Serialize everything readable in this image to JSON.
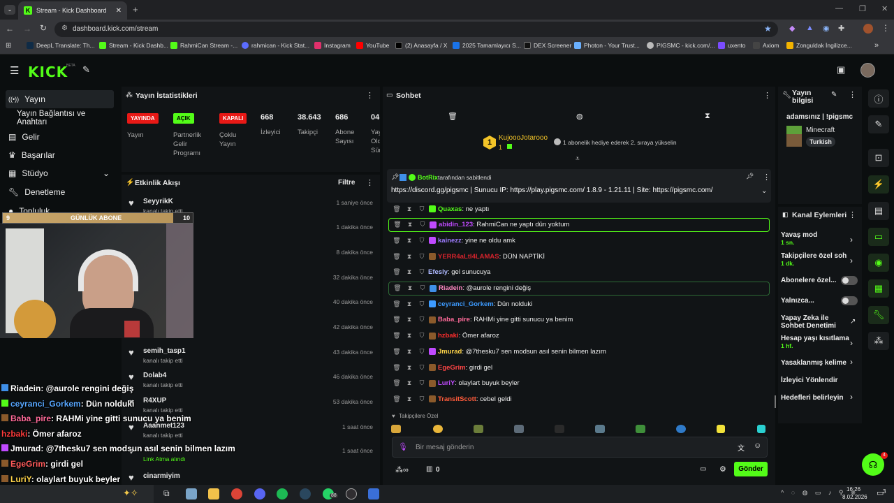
{
  "browser": {
    "tab_title": "Stream - Kick Dashboard",
    "url": "dashboard.kick.com/stream",
    "bookmarks": [
      "DeepL Translate: Th...",
      "Stream - Kick Dashb...",
      "RahmiCan Stream -...",
      "rahmican - Kick Stat...",
      "Instagram",
      "YouTube",
      "(2) Anasayfa / X",
      "2025 Tamamlayıcı S...",
      "DEX Screener",
      "Photon - Your Trust...",
      "PIGSMC - kick.com/...",
      "uxento",
      "Axiom",
      "Zonguldak İngilizce..."
    ]
  },
  "logo": "KICK",
  "logo_beta": "BETA",
  "sidebar": {
    "yayin": "Yayın",
    "baglanti": "Yayın Bağlantısı ve Anahtarı",
    "gelir": "Gelir",
    "basarilar": "Başarılar",
    "studyo": "Stüdyo",
    "denetleme": "Denetleme",
    "topluluk": "Topluluk",
    "odul": "Promo ve ödüller"
  },
  "overlay": {
    "goal_count": "9",
    "goal_label": "GÜNLÜK ABONE",
    "goal_target": "10",
    "chat": [
      {
        "u": "Riadein",
        "t": ": @aurole rengini değiş",
        "c": "#ffffff"
      },
      {
        "u": "ceyranci_Gorkem",
        "t": ": Dün nolduki",
        "c": "#57a7ff"
      },
      {
        "u": "Baba_pire",
        "t": ": RAHMi yine gitti sunucu ya benim",
        "c": "#ff6b9a"
      },
      {
        "u": "hzbaki",
        "t": ": Ömer afaroz",
        "c": "#ff3b3b"
      },
      {
        "u": "Jmurad",
        "t": ": @7thesku7 sen modsun asıl senin bilmen lazım",
        "c": "#ffffff"
      },
      {
        "u": "EgeGrim",
        "t": ": girdi gel",
        "c": "#ff5b5b"
      },
      {
        "u": "LuriY",
        "t": ": olaylart buyuk beyler",
        "c": "#ffd54a"
      },
      {
        "u": "TransitScott",
        "t": ": cebel geldi",
        "c": "#ffffff"
      }
    ]
  },
  "stats": {
    "title": "Yayın İstatistikleri",
    "b1": "YAYINDA",
    "b2": "AÇIK",
    "b3": "KAPALI",
    "l1": "Yayın",
    "l2": "Partnerlik Gelir Programı",
    "l3": "Çoklu Yayın",
    "viewers": "668",
    "viewers_lbl": "İzleyici",
    "followers": "38.643",
    "followers_lbl": "Takipçi",
    "subs": "686",
    "subs_lbl": "Abone Sayısı",
    "extra": "04:",
    "extra_lbl": "Yayın Olduğu Süre"
  },
  "activity": {
    "title": "Etkinlik Akışı",
    "filter": "Filtre",
    "items": [
      {
        "name": "SeyyrikK",
        "sub": "kanalı takip etti",
        "time": "1 saniye önce"
      },
      {
        "name": "SeyyrikK",
        "sub": "",
        "time": "1 dakika önce"
      },
      {
        "name": "",
        "sub": "",
        "time": "8 dakika önce"
      },
      {
        "name": "",
        "sub": "",
        "time": "32 dakika önce"
      },
      {
        "name": "",
        "sub": "",
        "time": "40 dakika önce"
      },
      {
        "name": "",
        "sub": "Link Atma alındı",
        "time": "42 dakika önce"
      },
      {
        "name": "semih_tasp1",
        "sub": "kanalı takip etti",
        "time": "43 dakika önce"
      },
      {
        "name": "Dolab4",
        "sub": "kanalı takip etti",
        "time": "46 dakika önce"
      },
      {
        "name": "R4XUP",
        "sub": "kanalı takip etti",
        "time": "53 dakika önce"
      },
      {
        "name": "Aaahmet123",
        "sub": "kanalı takip etti",
        "time": "1 saat önce"
      },
      {
        "name": "",
        "sub": "Link Atma alındı",
        "time": "1 saat önce"
      },
      {
        "name": "cinarmiyim",
        "sub": "",
        "time": ""
      }
    ]
  },
  "chat": {
    "title": "Sohbet",
    "top_user": "KujoooJotarooo",
    "top_rank": "1",
    "top_sub_count": "1",
    "top_msg": "1 abonelik hediye ederek 2. sıraya yükselin",
    "pinned_by": "BotRix",
    "pinned_lbl": "tarafından sabitlendi",
    "pinned_msg": "https://discord.gg/pigsmc | Sunucu IP: https://play.pigsmc.com/ 1.8.9 - 1.21.11 | Site: https://pigsmc.com/",
    "messages": [
      {
        "u": "Quaxas",
        "t": ": ne yaptı",
        "c": "#53fc18"
      },
      {
        "u": "abidin_123",
        "t": ": RahmiCan ne yaptı dün yoktum",
        "c": "#c04aff"
      },
      {
        "u": "kainezz",
        "t": ": yine ne oldu amk",
        "c": "#9d7cff"
      },
      {
        "u": "YERR4aLtI4LAMAS",
        "t": ": DÜN NAPTİKİ",
        "c": "#d4232c"
      },
      {
        "u": "Efesly",
        "t": ": gel sunucuya",
        "c": "#aeb9ff"
      },
      {
        "u": "Riadein",
        "t": ": @aurole rengini değiş",
        "c": "#ff8ac2"
      },
      {
        "u": "ceyranci_Gorkem",
        "t": ": Dün nolduki",
        "c": "#3d9bff"
      },
      {
        "u": "Baba_pire",
        "t": ": RAHMi yine gitti sunucu ya benim",
        "c": "#ff6b9a"
      },
      {
        "u": "hzbaki",
        "t": ": Ömer afaroz",
        "c": "#ff2d2d"
      },
      {
        "u": "Jmurad",
        "t": ": @7thesku7 sen modsun asıl senin bilmen lazım",
        "c": "#ffd54a"
      },
      {
        "u": "EgeGrim",
        "t": ": girdi gel",
        "c": "#ff4545"
      },
      {
        "u": "LuriY",
        "t": ": olaylart buyuk beyler",
        "c": "#c04aff"
      },
      {
        "u": "TransitScott",
        "t": ": cebel geldi",
        "c": "#ff5b3b"
      }
    ],
    "followers_only": "Takipçilere Özel",
    "placeholder": "Bir mesaj gönderin",
    "send": "Gönder",
    "count": "0"
  },
  "info": {
    "title": "Yayın bilgisi",
    "stream_title": "adamsınız | !pigsmc",
    "category": "Minecraft",
    "lang": "Turkish"
  },
  "actions": {
    "title": "Kanal Eylemleri",
    "slow": "Yavaş mod",
    "slow_v": "1 sn.",
    "follow": "Takipçilere özel soh",
    "follow_v": "1 dk.",
    "subs": "Abonelere özel...",
    "only": "Yalnızca...",
    "ai": "Yapay Zeka ile Sohbet Denetimi",
    "age": "Hesap yaşı kısıtlama",
    "age_v": "1 hf.",
    "banned": "Yasaklanmış kelime",
    "redirect": "İzleyici Yönlendir",
    "goals": "Hedefleri belirleyin"
  },
  "taskbar": {
    "time": "16:26",
    "date": "8.02.2026",
    "notif": "3",
    "wa": "88"
  }
}
